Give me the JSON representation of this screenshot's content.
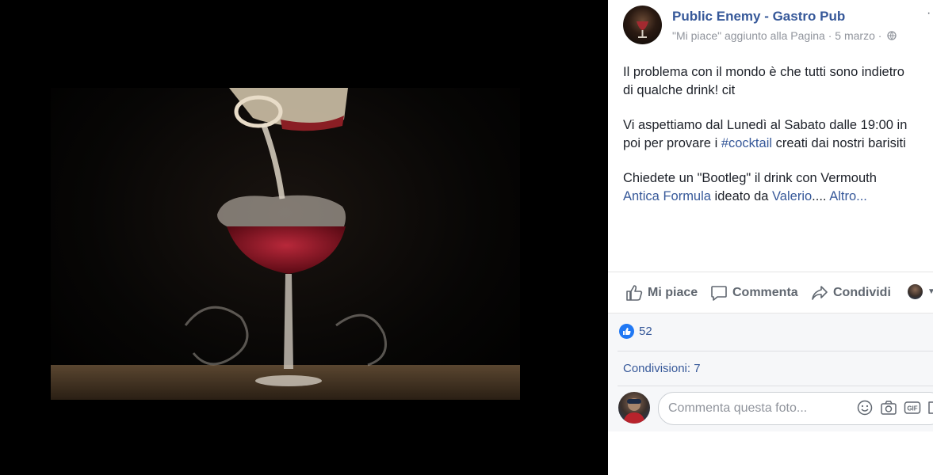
{
  "post": {
    "page_name": "Public Enemy - Gastro Pub",
    "meta_text": "\"Mi piace\" aggiunto alla Pagina · 5 marzo ·",
    "more": "··",
    "paragraph1_line1": "Il problema con il mondo è che tutti sono indietro",
    "paragraph1_line2": "di qualche drink! cit",
    "paragraph2_line1": "Vi aspettiamo dal Lunedì al Sabato dalle 19:00 in",
    "paragraph2_line2_pre": "poi per provare i ",
    "paragraph2_hashtag": "#cocktail",
    "paragraph2_line2_post": " creati dai nostri barisiti",
    "paragraph3_line1": "Chiedete un \"Bootleg\" il drink con Vermouth",
    "paragraph3_link1": "Antica Formula",
    "paragraph3_mid": " ideato da ",
    "paragraph3_link2": "Valerio",
    "paragraph3_ellipsis": ".... ",
    "paragraph3_more": "Altro..."
  },
  "actions": {
    "like": "Mi piace",
    "comment": "Commenta",
    "share": "Condividi"
  },
  "stats": {
    "likes": "52",
    "shares": "Condivisioni: 7"
  },
  "comment": {
    "placeholder": "Commenta questa foto..."
  },
  "colors": {
    "link": "#365899",
    "text": "#1d2129",
    "muted": "#90949c",
    "like_blue": "#2078f4"
  },
  "icons": {
    "globe": "globe-icon",
    "thumb": "thumbs-up-icon",
    "comment": "comment-bubble-icon",
    "share": "share-arrow-icon",
    "emoji": "emoji-icon",
    "camera": "camera-icon",
    "gif": "gif-icon",
    "sticker": "sticker-icon"
  }
}
